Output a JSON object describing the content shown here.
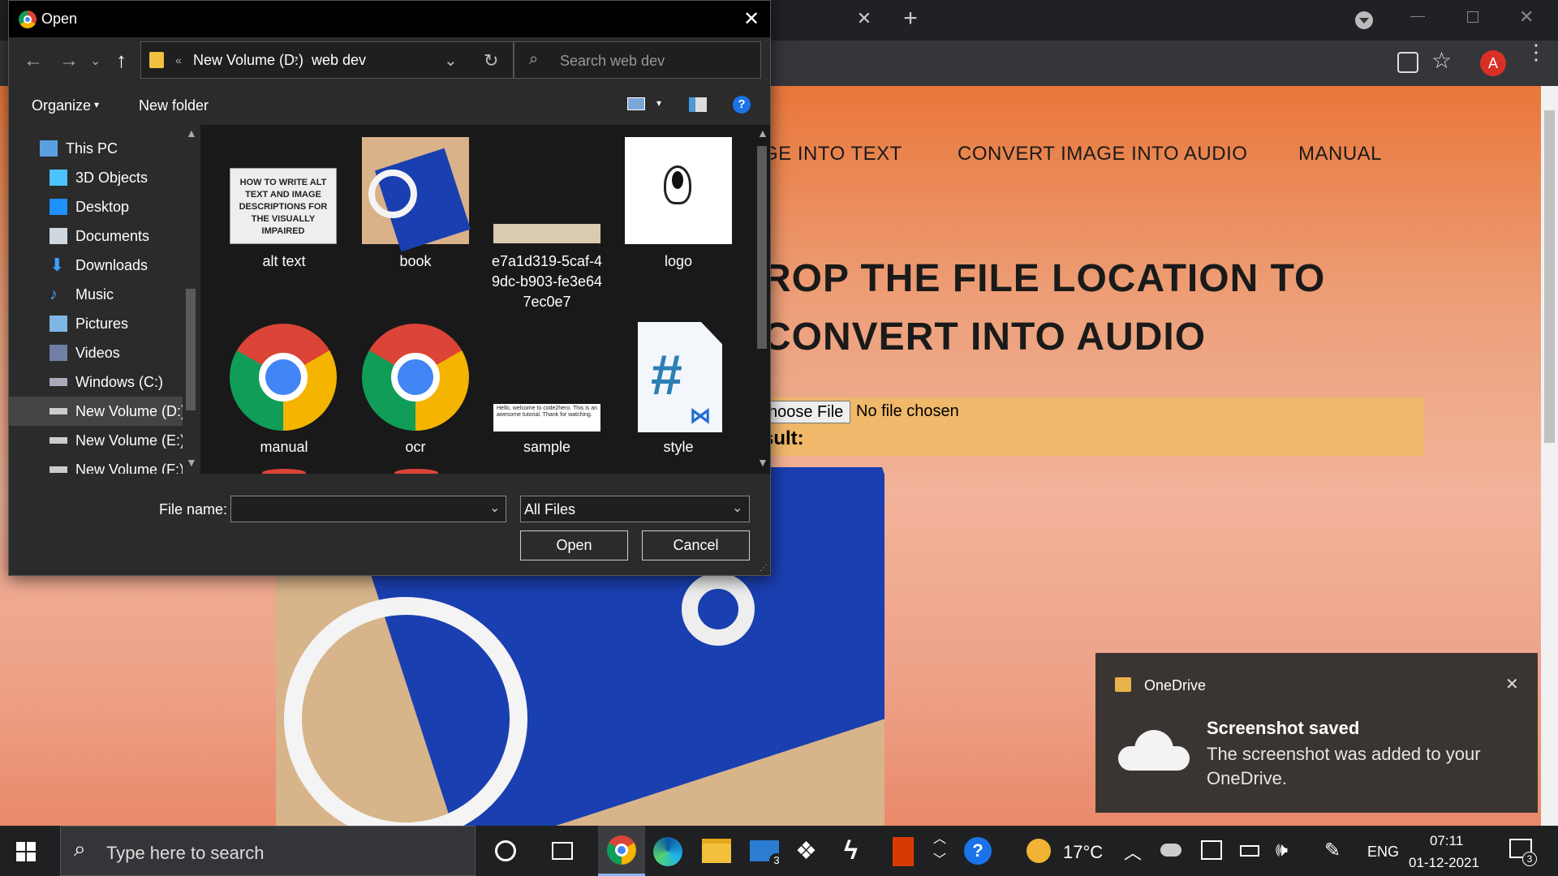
{
  "dialog": {
    "title": "Open",
    "breadcrumb": [
      "«",
      "New Volume (D:)",
      "web dev"
    ],
    "search_placeholder": "Search web dev",
    "organize_label": "Organize",
    "new_folder_label": "New folder",
    "help_label": "?",
    "nav_items": [
      {
        "label": "This PC",
        "icon": "computer-icon"
      },
      {
        "label": "3D Objects",
        "icon": "cube-icon"
      },
      {
        "label": "Desktop",
        "icon": "desktop-icon"
      },
      {
        "label": "Documents",
        "icon": "documents-icon"
      },
      {
        "label": "Downloads",
        "icon": "download-icon"
      },
      {
        "label": "Music",
        "icon": "music-icon"
      },
      {
        "label": "Pictures",
        "icon": "pictures-icon"
      },
      {
        "label": "Videos",
        "icon": "videos-icon"
      },
      {
        "label": "Windows (C:)",
        "icon": "drive-icon"
      },
      {
        "label": "New Volume (D:)",
        "icon": "drive-icon",
        "selected": true
      },
      {
        "label": "New Volume (E:)",
        "icon": "drive-icon"
      },
      {
        "label": "New Volume (F:)",
        "icon": "drive-icon"
      }
    ],
    "files": [
      {
        "name": "alt text",
        "thumb": "HOW TO WRITE ALT TEXT AND IMAGE DESCRIPTIONS FOR THE VISUALLY IMPAIRED"
      },
      {
        "name": "book"
      },
      {
        "name": "e7a1d319-5caf-4\n9dc-b903-fe3e64\n7ec0e7"
      },
      {
        "name": "logo"
      },
      {
        "name": "manual",
        "icon": "chrome-icon"
      },
      {
        "name": "ocr",
        "icon": "chrome-icon"
      },
      {
        "name": "sample",
        "thumb": "Hello, welcome to code2hero. This is an awesome tutorial. Thank for watching."
      },
      {
        "name": "style",
        "icon": "css-file-icon"
      }
    ],
    "file_name_label": "File name:",
    "file_name_value": "",
    "file_type_value": "All Files",
    "open_label": "Open",
    "cancel_label": "Cancel"
  },
  "browser": {
    "nav_links": [
      "GE INTO TEXT",
      "CONVERT IMAGE INTO AUDIO",
      "MANUAL"
    ],
    "headline_line1": "ROP THE FILE LOCATION TO",
    "headline_line2": "CONVERT INTO AUDIO",
    "choose_file_label": "hoose File",
    "no_file_text": "No file chosen",
    "result_label": "sult:",
    "avatar_letter": "A",
    "accent_color": "#e9773a"
  },
  "toast": {
    "app_name": "OneDrive",
    "title": "Screenshot saved",
    "message": "The screenshot was added to your OneDrive."
  },
  "taskbar": {
    "search_placeholder": "Type here to search",
    "mail_badge": "3",
    "temperature": "17°C",
    "language": "ENG",
    "time": "07:11",
    "date": "01-12-2021",
    "notification_count": "3"
  }
}
